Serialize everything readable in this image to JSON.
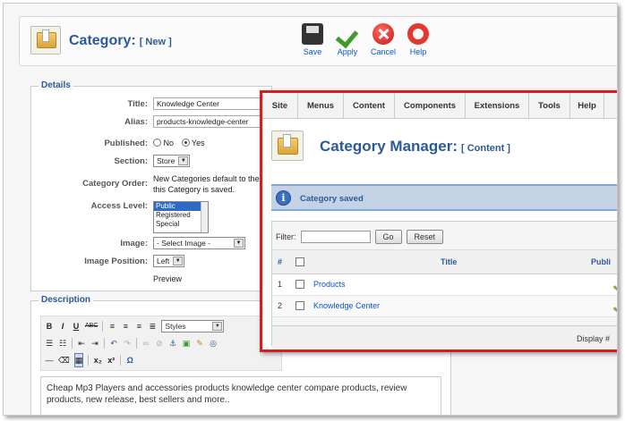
{
  "back_window": {
    "title": "Category:",
    "title_sub": "[ New ]",
    "toolbar": {
      "save_label": "Save",
      "apply_label": "Apply",
      "cancel_label": "Cancel",
      "help_label": "Help"
    },
    "details": {
      "legend": "Details",
      "title_label": "Title:",
      "title_value": "Knowledge Center",
      "alias_label": "Alias:",
      "alias_value": "products-knowledge-center",
      "published_label": "Published:",
      "published_no": "No",
      "published_yes": "Yes",
      "section_label": "Section:",
      "section_value": "Store",
      "category_order_label": "Category Order:",
      "category_order_text_1": "New Categories default to the l",
      "category_order_text_2": "this Category is saved.",
      "access_level_label": "Access Level:",
      "access_levels": [
        "Public",
        "Registered",
        "Special"
      ],
      "image_label": "Image:",
      "image_value": "- Select Image -",
      "image_position_label": "Image Position:",
      "image_position_value": "Left",
      "preview_label": "Preview"
    },
    "description": {
      "legend": "Description",
      "styles_select": "Styles",
      "text": "Cheap Mp3 Players and accessories products knowledge center compare products, review products, new release, best sellers and more.."
    }
  },
  "manager_window": {
    "menu": [
      "Site",
      "Menus",
      "Content",
      "Components",
      "Extensions",
      "Tools",
      "Help"
    ],
    "title": "Category Manager:",
    "title_sub": "[ Content ]",
    "message": "Category saved",
    "filter_label": "Filter:",
    "go_button": "Go",
    "reset_button": "Reset",
    "columns": {
      "num": "#",
      "title": "Title",
      "published": "Publi"
    },
    "rows": [
      {
        "num": "1",
        "title": "Products"
      },
      {
        "num": "2",
        "title": "Knowledge Center"
      }
    ],
    "display_text": "Display #"
  },
  "colors": {
    "title_blue": "#2d5a96",
    "highlight_frame": "#d21f1f",
    "message_bg": "#c3d2e5",
    "link": "#0b55c4"
  },
  "icons": {
    "category": "folder-document-icon",
    "save": "floppy-disk-icon",
    "apply": "checkmark-icon",
    "cancel": "cancel-x-icon",
    "help": "lifebuoy-icon",
    "info": "info-icon"
  }
}
